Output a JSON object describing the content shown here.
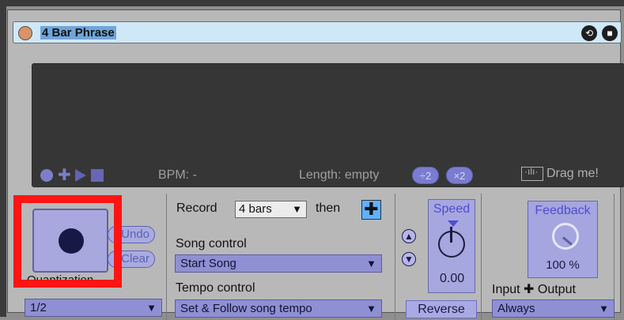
{
  "device": {
    "title": "4 Bar Phrase",
    "title_icons": [
      "reset-icon",
      "save-icon"
    ]
  },
  "display": {
    "transport_icons": [
      "record-icon",
      "add-icon",
      "play-icon",
      "stop-icon"
    ],
    "bpm_text": "BPM: -",
    "length_text": "Length: empty",
    "div2_label": "÷2",
    "mult2_label": "×2",
    "drag_text": "Drag me!"
  },
  "recording": {
    "undo_label": "Undo",
    "clear_label": "Clear",
    "quantization_label": "Quantization",
    "quantization_value": "1/2"
  },
  "record": {
    "record_label": "Record",
    "bars_value": "4 bars",
    "then_label": "then",
    "plus_label": "✚"
  },
  "song_control": {
    "label": "Song control",
    "value": "Start Song"
  },
  "tempo_control": {
    "label": "Tempo control",
    "value": "Set & Follow song tempo"
  },
  "speed": {
    "label": "Speed",
    "value": "0.00",
    "reverse_label": "Reverse",
    "up_icon": "arrow-up-icon",
    "down_icon": "arrow-down-icon"
  },
  "feedback": {
    "label": "Feedback",
    "value": "100 %",
    "io_label": "Input ✚ Output",
    "io_value": "Always"
  },
  "colors": {
    "accent": "#7d7dd0",
    "record_highlight": "#ff1414",
    "title_bg": "#cfe8f7"
  }
}
